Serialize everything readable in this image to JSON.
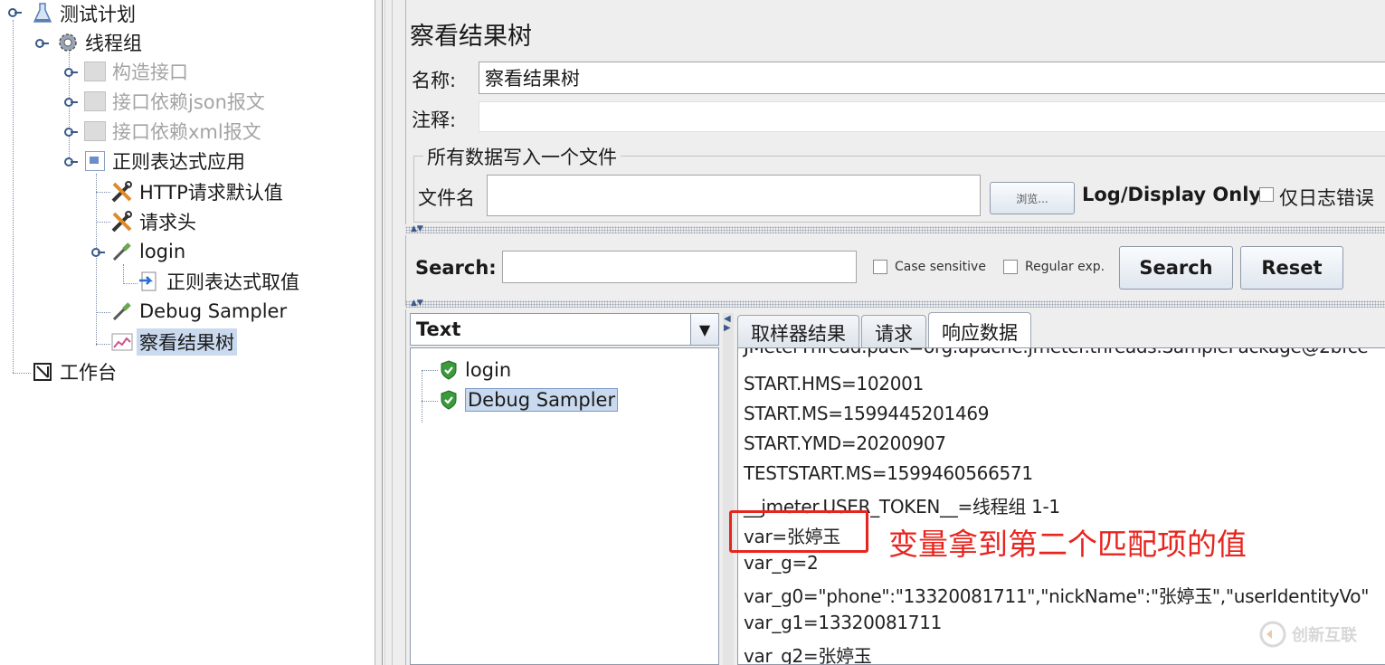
{
  "tree": {
    "items": [
      {
        "label": "测试计划",
        "icon": "flask-icon"
      },
      {
        "label": "线程组",
        "icon": "gear-icon"
      },
      {
        "label": "构造接口",
        "icon": "disabled-controller-icon"
      },
      {
        "label": "接口依赖json报文",
        "icon": "disabled-controller-icon"
      },
      {
        "label": "接口依赖xml报文",
        "icon": "disabled-controller-icon"
      },
      {
        "label": "正则表达式应用",
        "icon": "controller-icon"
      },
      {
        "label": "HTTP请求默认值",
        "icon": "wrench-icon"
      },
      {
        "label": "请求头",
        "icon": "wrench-icon"
      },
      {
        "label": "login",
        "icon": "pipette-icon"
      },
      {
        "label": "正则表达式取值",
        "icon": "extractor-icon"
      },
      {
        "label": "Debug Sampler",
        "icon": "pipette-icon"
      },
      {
        "label": "察看结果树",
        "icon": "graph-icon"
      },
      {
        "label": "工作台",
        "icon": "workbench-icon"
      }
    ]
  },
  "panel": {
    "title": "察看结果树",
    "name_label": "名称:",
    "name_value": "察看结果树",
    "comment_label": "注释:",
    "group_title": "所有数据写入一个文件",
    "filename_label": "文件名",
    "browse_label": "浏览...",
    "log_display_label": "Log/Display Only:",
    "errors_only_label": "仅日志错误"
  },
  "search": {
    "label": "Search:",
    "case_sensitive": "Case sensitive",
    "regular_exp": "Regular exp.",
    "search_button": "Search",
    "reset_button": "Reset"
  },
  "results": {
    "renderer": "Text",
    "nodes": [
      {
        "label": "login"
      },
      {
        "label": "Debug Sampler"
      }
    ],
    "tabs": [
      "取样器结果",
      "请求",
      "响应数据"
    ],
    "lines": [
      "JMeterThread.pack=org.apache.jmeter.threads.SamplePackage@2bfce",
      "START.HMS=102001",
      "START.MS=1599445201469",
      "START.YMD=20200907",
      "TESTSTART.MS=1599460566571",
      "__jmeter.USER_TOKEN__=线程组 1-1",
      "var=张婷玉",
      "var_g=2",
      "var_g0=\"phone\":\"13320081711\",\"nickName\":\"张婷玉\",\"userIdentityVo\"",
      "var_g1=13320081711",
      "var_g2=张婷玉"
    ]
  },
  "annotation": {
    "text": "变量拿到第二个匹配项的值"
  },
  "watermark": {
    "text": "创新互联"
  },
  "colors": {
    "annotation": "#e8241e",
    "selection": "#c9d9ee",
    "panel_bg": "#eeeeee"
  }
}
